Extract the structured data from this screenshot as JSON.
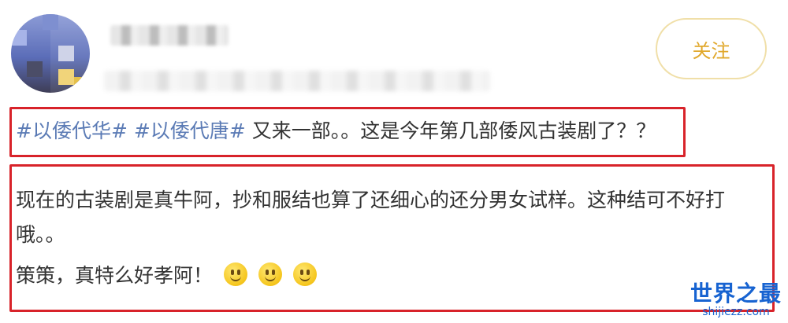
{
  "post": {
    "follow_label": "关注",
    "hashtags": [
      "#以倭代华#",
      "#以倭代唐#"
    ],
    "headline_text": "又来一部。。这是今年第几部倭风古装剧了？？",
    "comment_line1": "现在的古装剧是真牛阿，抄和服结也算了还细心的还分男女试样。这种结可不好打",
    "comment_line2": "哦。。",
    "comment_line3": "策策，真特么好孝阿！",
    "emoji_icons": [
      "smile-emoji-icon",
      "smile-emoji-icon",
      "smile-emoji-icon"
    ]
  },
  "watermark": {
    "title": "世界之最",
    "url": "shijiezz.com"
  },
  "colors": {
    "highlight_box": "#d8232a",
    "hashtag": "#5b7bb5",
    "follow_text": "#e0a72a",
    "watermark": "#1763d1"
  }
}
